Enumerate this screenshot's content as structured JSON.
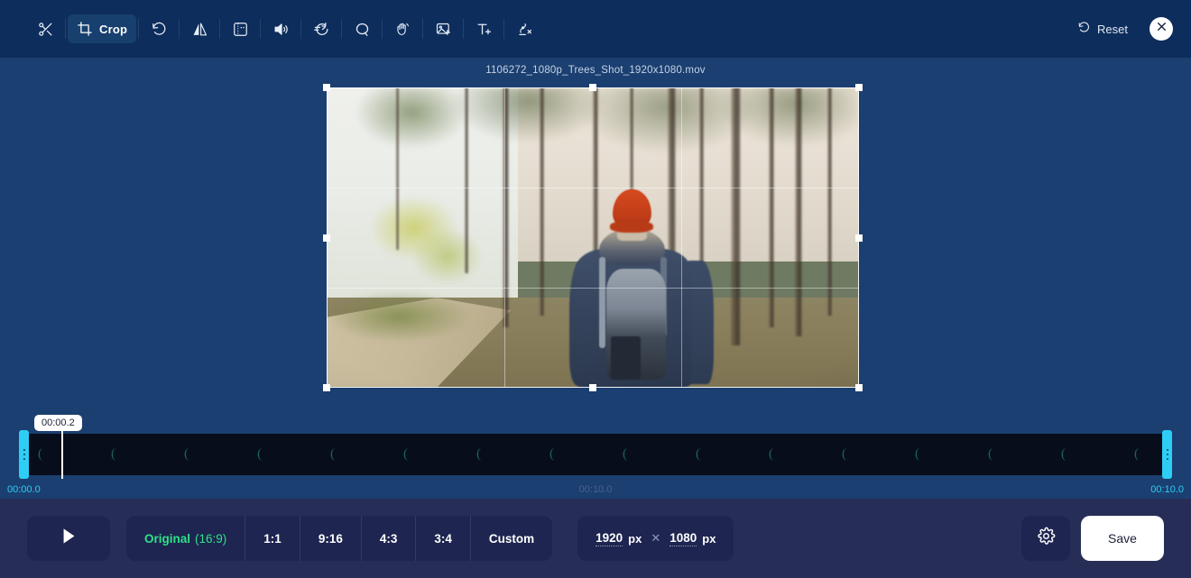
{
  "toolbar": {
    "tools": [
      {
        "icon": "scissors-icon",
        "label": ""
      },
      {
        "icon": "crop-icon",
        "label": "Crop"
      },
      {
        "icon": "rotate-icon",
        "label": ""
      },
      {
        "icon": "flip-icon",
        "label": ""
      },
      {
        "icon": "frame-icon",
        "label": ""
      },
      {
        "icon": "volume-icon",
        "label": ""
      },
      {
        "icon": "speed-icon",
        "label": ""
      },
      {
        "icon": "loop-icon",
        "label": ""
      },
      {
        "icon": "wave-hand-icon",
        "label": ""
      },
      {
        "icon": "add-image-icon",
        "label": ""
      },
      {
        "icon": "add-text-icon",
        "label": ""
      },
      {
        "icon": "remove-watermark-icon",
        "label": ""
      }
    ],
    "reset_label": "Reset",
    "reset_icon": "reset-icon",
    "close_icon": "close-icon"
  },
  "canvas": {
    "filename": "1106272_1080p_Trees_Shot_1920x1080.mov"
  },
  "timeline": {
    "playhead_tooltip": "00:00.2",
    "start_time": "00:00.0",
    "mid_time": "00:10.0",
    "end_time": "00:10.0",
    "wave_glyph": "(",
    "accent_color": "#2ecdf5"
  },
  "bottom": {
    "play_icon": "play-icon",
    "ratios": [
      {
        "label": "Original",
        "sub": "(16:9)",
        "selected": true
      },
      {
        "label": "1:1",
        "sub": "",
        "selected": false
      },
      {
        "label": "9:16",
        "sub": "",
        "selected": false
      },
      {
        "label": "4:3",
        "sub": "",
        "selected": false
      },
      {
        "label": "3:4",
        "sub": "",
        "selected": false
      },
      {
        "label": "Custom",
        "sub": "",
        "selected": false
      }
    ],
    "width_value": "1920",
    "width_unit": "px",
    "x_symbol": "✕",
    "height_value": "1080",
    "height_unit": "px",
    "gear_icon": "gear-icon",
    "save_label": "Save",
    "selected_color": "#2fe08a"
  }
}
